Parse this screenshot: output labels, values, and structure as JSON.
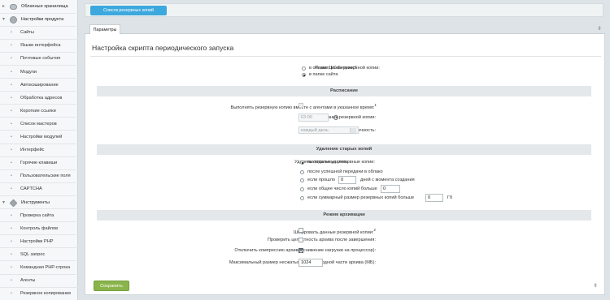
{
  "sidebar": {
    "items": [
      {
        "label": "Облачные хранилища",
        "type": "top",
        "icon": "cloud-icon",
        "arrow": "▸"
      },
      {
        "label": "Настройки продукта",
        "type": "top",
        "icon": "settings-icon",
        "arrow": "▾"
      },
      {
        "label": "Сайты",
        "type": "sub"
      },
      {
        "label": "Языки интерфейса",
        "type": "sub"
      },
      {
        "label": "Почтовые события",
        "type": "sub"
      },
      {
        "label": "Модули",
        "type": "sub"
      },
      {
        "label": "Автокэширование",
        "type": "sub"
      },
      {
        "label": "Обработка адресов",
        "type": "sub"
      },
      {
        "label": "Короткие ссылки",
        "type": "sub"
      },
      {
        "label": "Список мастеров",
        "type": "sub"
      },
      {
        "label": "Настройки модулей",
        "type": "sub"
      },
      {
        "label": "Интерфейс",
        "type": "sub"
      },
      {
        "label": "Горячие клавиши",
        "type": "sub"
      },
      {
        "label": "Пользовательские поля",
        "type": "sub"
      },
      {
        "label": "CAPTCHA",
        "type": "sub"
      },
      {
        "label": "Инструменты",
        "type": "top",
        "icon": "tools-icon",
        "arrow": "▾"
      },
      {
        "label": "Проверка сайта",
        "type": "sub"
      },
      {
        "label": "Контроль файлов",
        "type": "sub"
      },
      {
        "label": "Настройки PHP",
        "type": "sub"
      },
      {
        "label": "SQL запрос",
        "type": "sub"
      },
      {
        "label": "Командная PHP-строка",
        "type": "sub"
      },
      {
        "label": "Агенты",
        "type": "sub"
      },
      {
        "label": "Резервное копирование",
        "type": "sub"
      }
    ]
  },
  "toolbar": {
    "backup_list_button": "Список резервных копий"
  },
  "tabs": [
    {
      "label": "Параметры"
    }
  ],
  "panel": {
    "title": "Настройка скрипта периодического запуска"
  },
  "placement": {
    "label": "Размещение резервной копии:",
    "options": [
      "в облаке \"1С-Битрикс\"",
      "в папке сайта"
    ],
    "selected": 1
  },
  "schedule": {
    "header": "Расписание",
    "agents_label": "Выполнять резервную копию вместе с агентами в указанное время:",
    "agents_note": "1",
    "time_label": "Время создания резервной копии:",
    "time_value": "03:00",
    "period_label": "Периодичность:",
    "period_value": "каждый день"
  },
  "cleanup": {
    "header": "Удаление старых копий",
    "label": "Удалять локальные резервные копии:",
    "options": [
      {
        "text": "никогда не удалять"
      },
      {
        "text": "после успешной передачи в облако"
      },
      {
        "text": "если прошло",
        "input": "0",
        "suffix": "дней с момента создания"
      },
      {
        "text": "если общее число копий больше",
        "input": "0"
      },
      {
        "text": "если суммарный размер резервных копий больше",
        "input": "0",
        "suffix": "Гб"
      }
    ],
    "selected": 0
  },
  "archive": {
    "header": "Режим архивации",
    "encrypt_label": "Шифровать данные резервной копии:",
    "encrypt_note": "2",
    "verify_label": "Проверить целостность архива после завершения:",
    "compress_label": "Отключить компрессию архива (снижение нагрузки на процессор):",
    "maxsize_label": "Максимальный размер несжатых данных в одной части архива (МБ):",
    "maxsize_value": "1024"
  },
  "footer": {
    "save_button": "Сохранить"
  },
  "colors": {
    "accent": "#3da8dd",
    "save": "#8ab44b"
  }
}
